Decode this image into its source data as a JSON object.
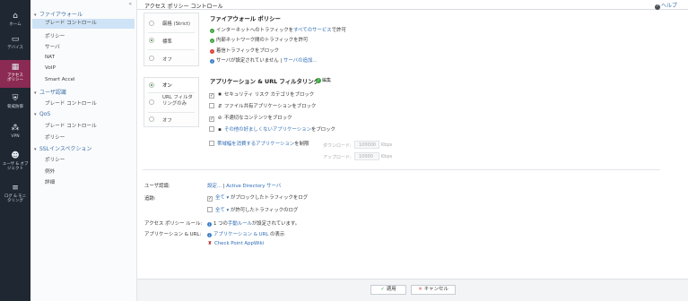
{
  "rail": {
    "items": [
      {
        "label": "ホーム",
        "icon": "home-icon",
        "glyph": "⌂"
      },
      {
        "label": "デバイス",
        "icon": "device-icon",
        "glyph": "▭"
      },
      {
        "label": "アクセス ポリシー",
        "icon": "grid-icon",
        "glyph": "▦"
      },
      {
        "label": "脅威防御",
        "icon": "shield-icon",
        "glyph": "⛨"
      },
      {
        "label": "VPN",
        "icon": "vpn-icon",
        "glyph": "⁂"
      },
      {
        "label": "ユーザ & オブジェクト",
        "icon": "users-icon",
        "glyph": "☻"
      },
      {
        "label": "ログ & モニタリング",
        "icon": "logs-icon",
        "glyph": "≡"
      }
    ]
  },
  "tree": {
    "collapse_glyph": "«",
    "firewall_group": "ファイアウォール",
    "firewall_items": [
      "ブレード コントロール",
      "ポリシー",
      "サーバ",
      "NAT",
      "VoIP",
      "Smart Accel"
    ],
    "user_group": "ユーザ認識",
    "user_items": [
      "ブレード コントロール"
    ],
    "qos_group": "QoS",
    "qos_items": [
      "ブレード コントロール",
      "ポリシー"
    ],
    "ssl_group": "SSLインスペクション",
    "ssl_items": [
      "ポリシー",
      "例外",
      "詳細"
    ]
  },
  "header": {
    "title": "アクセス ポリシー コントロール",
    "help": "ヘルプ"
  },
  "firewall": {
    "options": [
      "厳格 (Strict)",
      "標準",
      "オフ"
    ],
    "selected": "標準",
    "title": "ファイアウォール ポリシー",
    "line1_pre": "インターネットへのトラフィックを",
    "line1_link": "すべてのサービス",
    "line1_post": "で許可",
    "line2": "内部ネットワーク間のトラフィックを許可",
    "line3": "着信トラフィックをブロック",
    "line4_pre": "サーバが設定されていません | ",
    "line4_link": "サーバの追加..."
  },
  "appurl": {
    "options": [
      "オン",
      "URL フィルタリングのみ",
      "オフ"
    ],
    "selected": "オン",
    "title": "アプリケーション & URL フィルタリング",
    "edit": "編集",
    "items": [
      {
        "text": "セキュリティ リスク カテゴリをブロック",
        "checked": true,
        "icon": "✸"
      },
      {
        "text": "ファイル共有アプリケーションをブロック",
        "checked": false,
        "icon": "⇵"
      },
      {
        "text": "不適切なコンテンツをブロック",
        "checked": true,
        "icon": "⊘"
      }
    ],
    "other_link": "その他の好ましくないアプリケーション",
    "other_post": "をブロック",
    "bandwidth_link": "帯域幅を消費するアプリケーション",
    "bandwidth_pre": "",
    "bandwidth_post": "を制限",
    "download_label": "ダウンロード:",
    "download_value": "100000",
    "upload_label": "アップロード:",
    "upload_value": "10000",
    "unit": "Kbps"
  },
  "lower": {
    "user_label": "ユーザ認識:",
    "user_value_link": "設定...",
    "user_sep": " | ",
    "user_value_link2": "Active Directory サーバ",
    "track_label": "追跡:",
    "track1_link": "全て",
    "track1_text": "がブロックしたトラフィックをログ",
    "track2_link": "全て",
    "track2_text": "が許可したトラフィックのログ",
    "rules_label": "アクセス ポリシー ルール:",
    "rules_pre": "1 つの",
    "rules_link": "手動ルール",
    "rules_post": "が設定されています。",
    "app_label": "アプリケーション & URL:",
    "app_link": "アプリケーション & URL",
    "app_post": " の表示",
    "appwiki": "Check Point AppWiki"
  },
  "footer": {
    "apply": "適用",
    "cancel": "キャンセル"
  }
}
